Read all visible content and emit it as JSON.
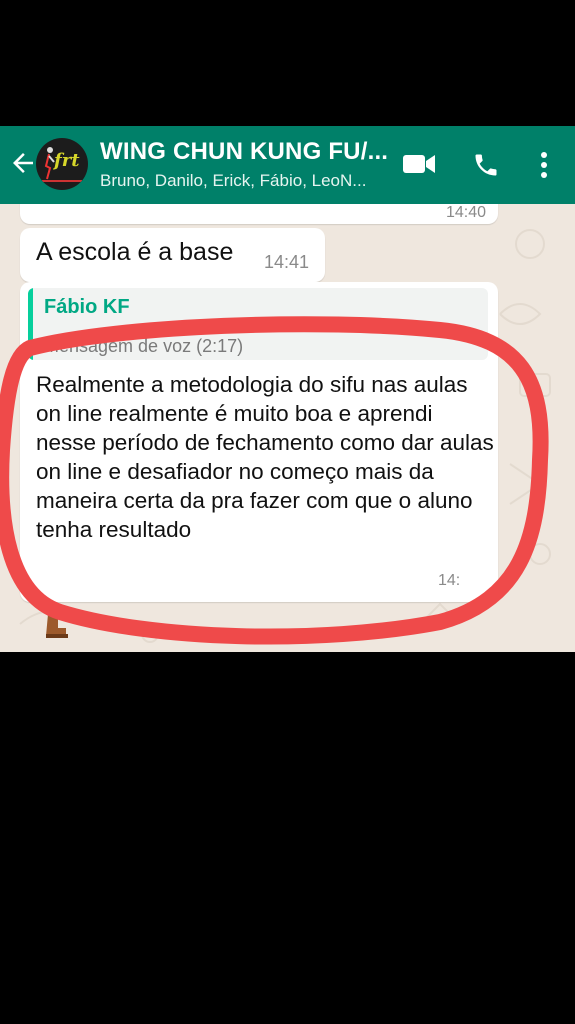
{
  "header": {
    "title": "WING CHUN KUNG FU/...",
    "participants": "Bruno, Danilo, Erick, Fábio, LeoN...",
    "avatar_logo_text": "frt",
    "icons": {
      "back": "arrow-left-icon",
      "video": "video-call-icon",
      "call": "phone-icon",
      "menu": "kebab-menu-icon"
    }
  },
  "messages": {
    "previous_time": "14:40",
    "base": {
      "text": "A escola é a base",
      "time": "14:41"
    },
    "quoted_reply": {
      "quoted_sender": "Fábio KF",
      "quoted_partial": "Mensagem de voz (2:17)",
      "text": "Realmente a metodologia do sifu nas aulas on line realmente é muito boa e aprendi nesse período de fechamento como dar aulas on line e desafiador no começo mais da maneira certa da pra fazer com que o aluno tenha resultado",
      "time": "14:"
    }
  },
  "colors": {
    "header": "#008069",
    "chat_background": "#efe7de",
    "bubble": "#ffffff",
    "quote_accent": "#06cf9c",
    "annotation": "#ef4a4a"
  }
}
